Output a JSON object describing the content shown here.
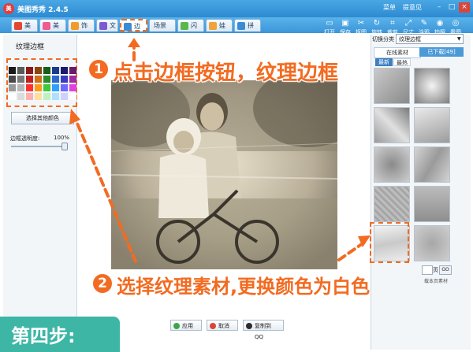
{
  "window": {
    "title": "美图秀秀 2.4.5",
    "menu_link": "菜单",
    "suggest_link": "提意见",
    "minimize": "–",
    "maximize": "□",
    "close": "×"
  },
  "tabs": [
    {
      "label": "美化",
      "color": "#e4462f"
    },
    {
      "label": "美容",
      "color": "#ef5a8f"
    },
    {
      "label": "饰品",
      "color": "#f29b2b"
    },
    {
      "label": "文字",
      "color": "#7c5bd1"
    },
    {
      "label": "边框",
      "color": "#3a8bd6"
    },
    {
      "label": "场景",
      "color": "#3a8bd6"
    },
    {
      "label": "闪图",
      "color": "#58b84a"
    },
    {
      "label": "娃娃",
      "color": "#f0a23c"
    },
    {
      "label": "拼图",
      "color": "#3a8bd6"
    }
  ],
  "tools": [
    {
      "label": "打开",
      "icon": "folder-icon",
      "glyph": "▭"
    },
    {
      "label": "保存",
      "icon": "save-icon",
      "glyph": "▣"
    },
    {
      "label": "抠图",
      "icon": "cutout-icon",
      "glyph": "✂"
    },
    {
      "label": "旋转",
      "icon": "rotate-icon",
      "glyph": "↻"
    },
    {
      "label": "裁剪",
      "icon": "crop-icon",
      "glyph": "⌗"
    },
    {
      "label": "尺寸",
      "icon": "resize-icon",
      "glyph": "⤢"
    },
    {
      "label": "涂鸦",
      "icon": "brush-icon",
      "glyph": "✎"
    },
    {
      "label": "拍照",
      "icon": "camera-icon",
      "glyph": "◉"
    },
    {
      "label": "看图",
      "icon": "eye-icon",
      "glyph": "◎"
    }
  ],
  "left_panel": {
    "title": "纹理边框",
    "swatch_colors": [
      "#1a1a1a",
      "#5a5a5a",
      "#8b1a1a",
      "#8b4513",
      "#1a5c1a",
      "#1a3c8b",
      "#1a1a6b",
      "#6b1a6b",
      "#4a4a4a",
      "#7a7a7a",
      "#c22020",
      "#d0701a",
      "#2a8c2a",
      "#2a6ad0",
      "#3a3ac0",
      "#a02aa0",
      "#9a9a9a",
      "#b8b8b8",
      "#ff3030",
      "#ff9a1a",
      "#3ec83e",
      "#30a0ff",
      "#6a6aff",
      "#e040e0",
      "#ffffff",
      "#dcdcdc",
      "#ffb0b0",
      "#ffe0a0",
      "#c0f0c0",
      "#b0e0ff",
      "#d0d0ff",
      "#ffffff"
    ],
    "more_colors": "选择其他颜色",
    "opacity_label": "边框透明度:",
    "opacity_value": "100%",
    "opacity_level": 1.0
  },
  "bottom": {
    "apply": "应用",
    "cancel": "取消",
    "copy_qq": "复制到QQ"
  },
  "right_panel": {
    "category_label": "切换分类",
    "category_value": "纹理边框",
    "tab_online": "在线素材",
    "tab_downloaded": "已下载[49]",
    "sort_new": "最新",
    "sort_hot": "最热",
    "page_label": "页",
    "go": "GO",
    "page_info": "载本页素材"
  },
  "annotations": {
    "step1_number": "1",
    "step1_text": "点击边框按钮，纹理边框",
    "step2_number": "2",
    "step2_text": "选择纹理素材,更换颜色为白色",
    "step_label": "第四步:"
  }
}
